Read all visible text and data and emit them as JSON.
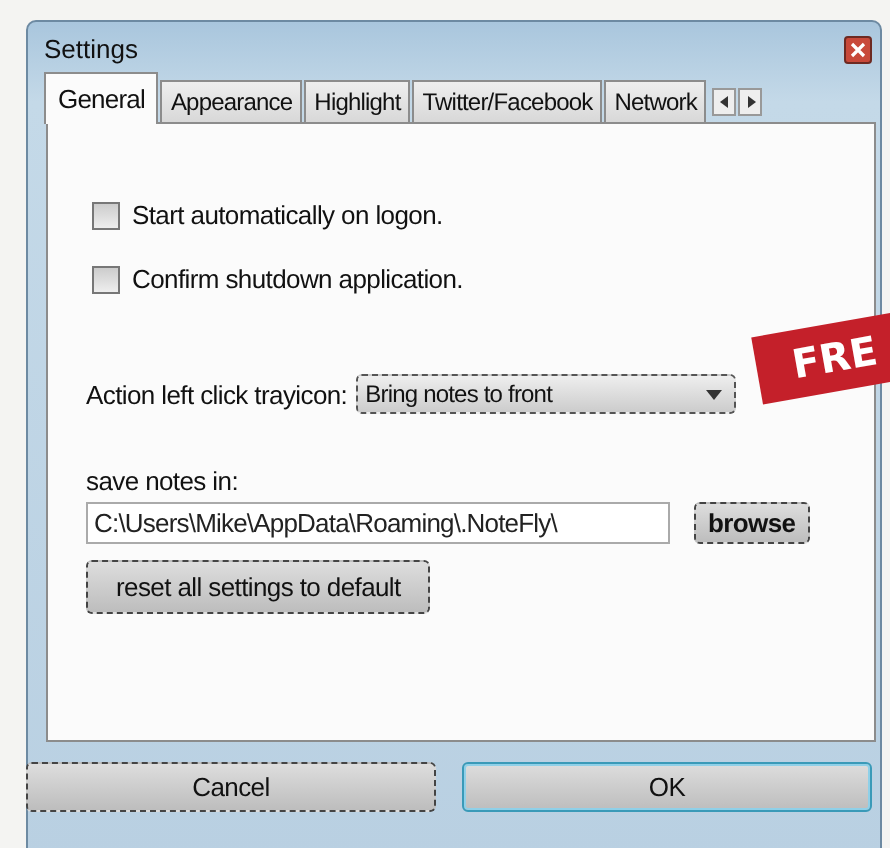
{
  "window": {
    "title": "Settings"
  },
  "tabs": [
    {
      "label": "General",
      "selected": true
    },
    {
      "label": "Appearance",
      "selected": false
    },
    {
      "label": "Highlight",
      "selected": false
    },
    {
      "label": "Twitter/Facebook",
      "selected": false
    },
    {
      "label": "Network",
      "selected": false
    }
  ],
  "options": [
    {
      "label": "Start automatically on logon.",
      "checked": false
    },
    {
      "label": "Confirm shutdown application.",
      "checked": false
    }
  ],
  "tray_action": {
    "label": "Action left click trayicon:",
    "value": "Bring notes to front"
  },
  "save_location": {
    "label": "save notes in:",
    "value": "C:\\Users\\Mike\\AppData\\Roaming\\.NoteFly\\",
    "browse": "browse"
  },
  "reset_button": "reset all settings to default",
  "buttons": [
    {
      "label": "Cancel",
      "default": false
    },
    {
      "label": "OK",
      "default": true
    }
  ],
  "banner": "FRE"
}
